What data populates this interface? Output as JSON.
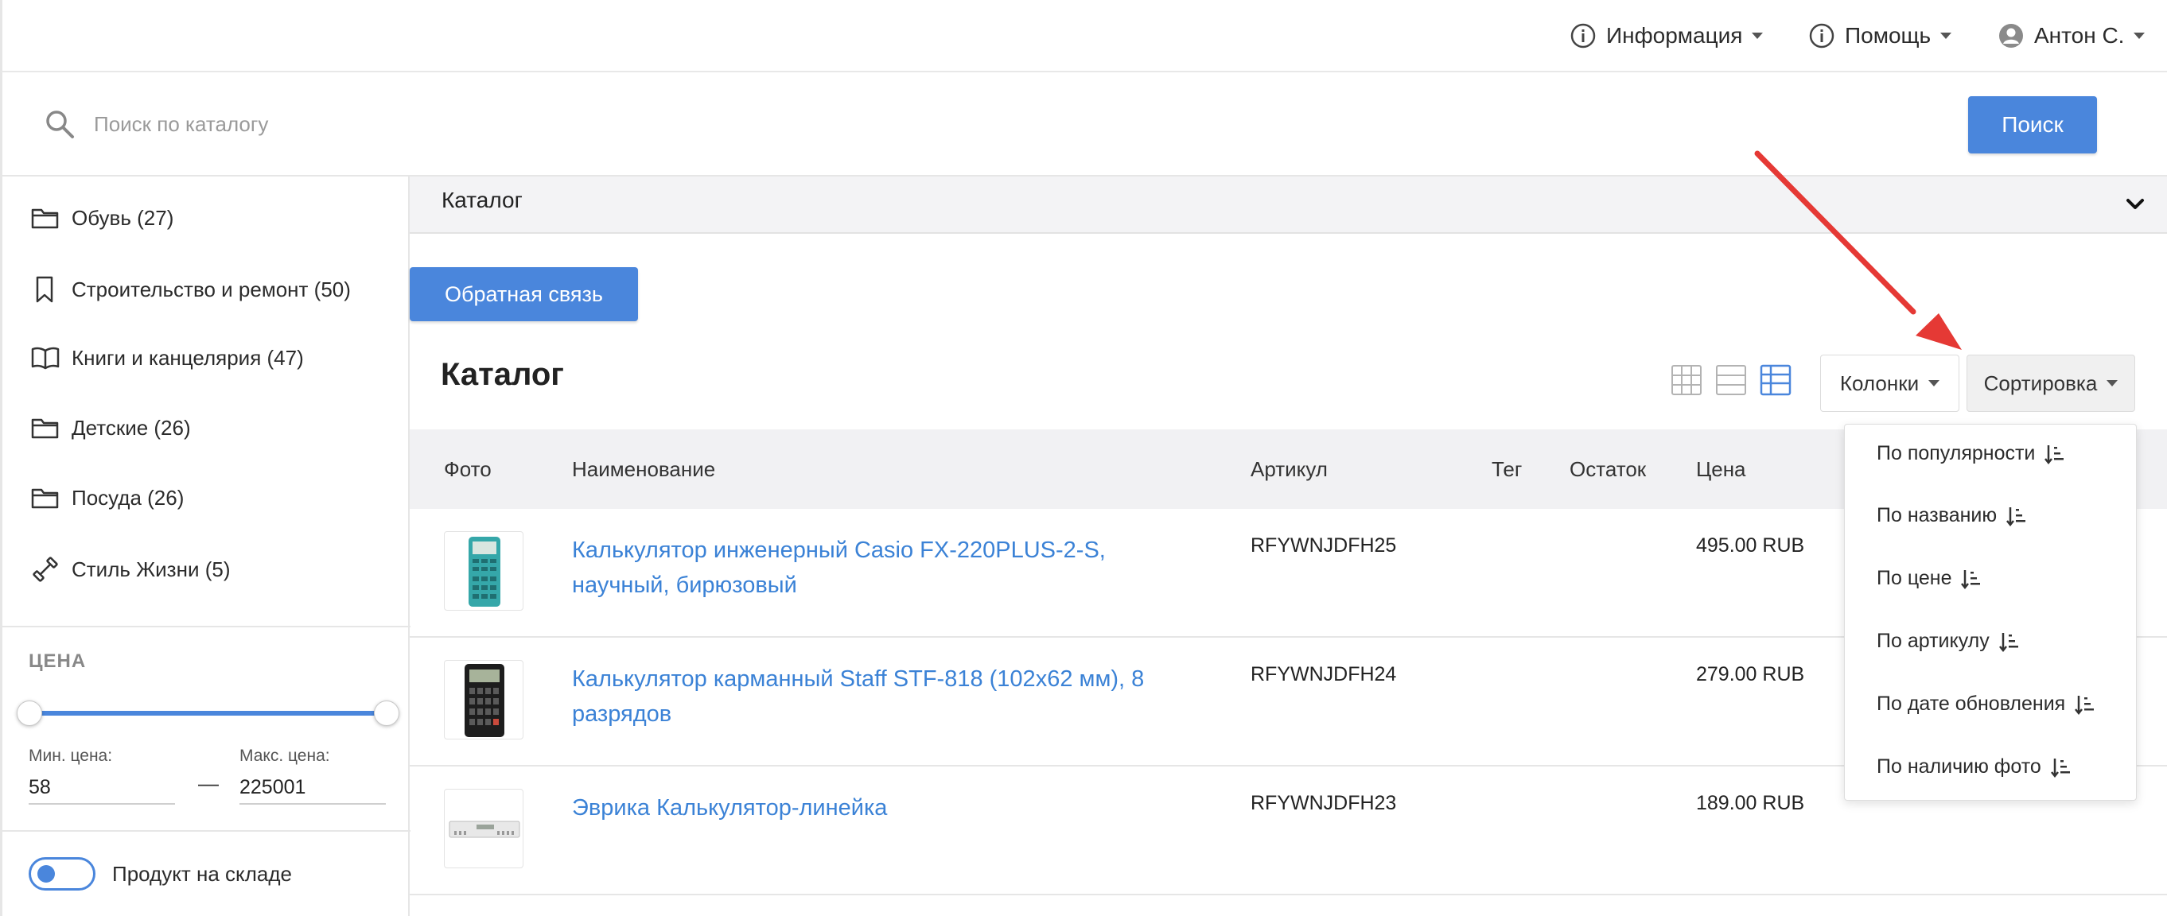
{
  "topbar": {
    "info_label": "Информация",
    "help_label": "Помощь",
    "user_label": "Антон С."
  },
  "search": {
    "placeholder": "Поиск по каталогу",
    "button_label": "Поиск"
  },
  "sidebar": {
    "categories": [
      {
        "label": "Обувь (27)",
        "icon": "folder-icon"
      },
      {
        "label": "Строительство и ремонт (50)",
        "icon": "bookmark-icon"
      },
      {
        "label": "Книги и канцелярия (47)",
        "icon": "book-icon"
      },
      {
        "label": "Детские (26)",
        "icon": "folder-icon"
      },
      {
        "label": "Посуда (26)",
        "icon": "folder-icon"
      },
      {
        "label": "Стиль Жизни (5)",
        "icon": "dumbbell-icon"
      }
    ],
    "price": {
      "title": "ЦЕНА",
      "min_label": "Мин. цена:",
      "max_label": "Макс. цена:",
      "min_value": "58",
      "max_value": "225001",
      "dash": "—"
    },
    "in_stock_label": "Продукт на складе"
  },
  "main": {
    "section_header": "Каталог",
    "feedback_label": "Обратная связь",
    "title": "Каталог",
    "columns_label": "Колонки",
    "sort_label": "Сортировка",
    "table": {
      "headers": [
        "Фото",
        "Наименование",
        "Артикул",
        "Тег",
        "Остаток",
        "Цена"
      ],
      "rows": [
        {
          "name": "Калькулятор инженерный Casio FX-220PLUS-2-S, научный, бирюзовый",
          "sku": "RFYWNJDFH25",
          "price": "495.00 RUB"
        },
        {
          "name": "Калькулятор карманный Staff STF-818 (102x62 мм), 8 разрядов",
          "sku": "RFYWNJDFH24",
          "price": "279.00 RUB"
        },
        {
          "name": "Эврика Калькулятор-линейка",
          "sku": "RFYWNJDFH23",
          "price": "189.00 RUB"
        }
      ]
    },
    "sort_options": [
      "По популярности",
      "По названию",
      "По цене",
      "По артикулу",
      "По дате обновления",
      "По наличию фото"
    ]
  },
  "colors": {
    "accent": "#4a86dc",
    "link": "#3b82d6",
    "annotation_arrow": "#e53935"
  }
}
